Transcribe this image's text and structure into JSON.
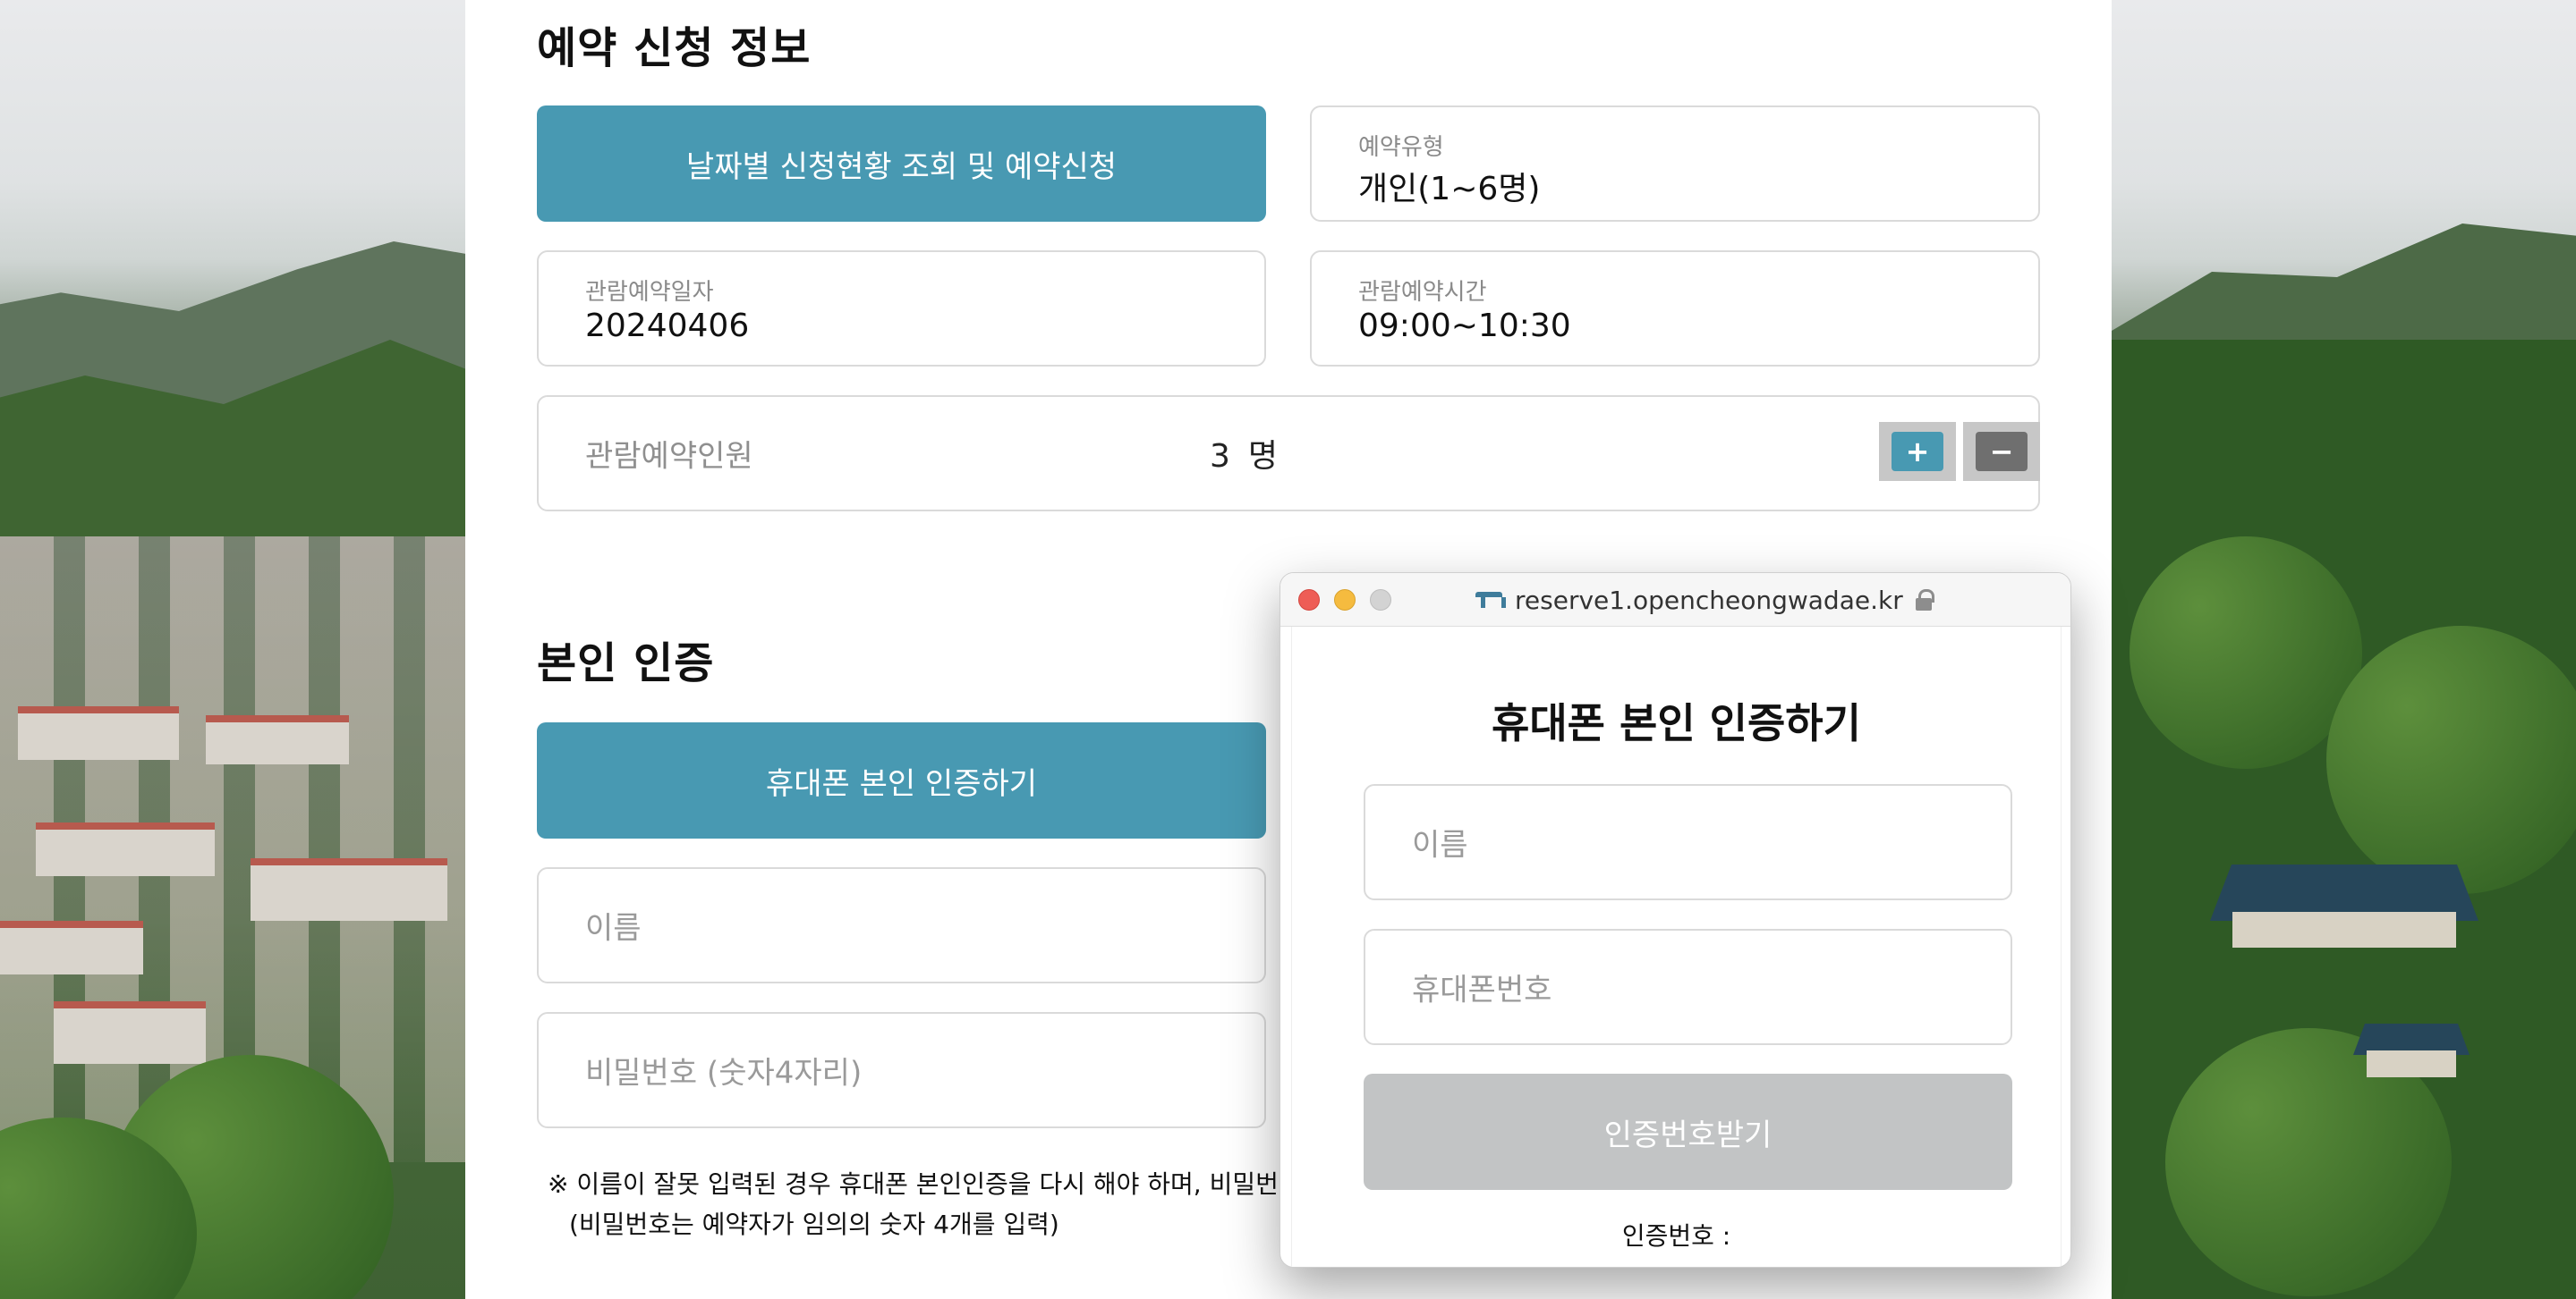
{
  "reservation": {
    "title": "예약 신청 정보",
    "date_status_button": "날짜별 신청현황 조회 및 예약신청",
    "type_label": "예약유형",
    "type_value": "개인(1~6명)",
    "date_label": "관람예약일자",
    "date_value": "20240406",
    "time_label": "관람예약시간",
    "time_value": "09:00~10:30",
    "people_label": "관람예약인원",
    "people_count": "3",
    "people_unit": "명",
    "plus": "+",
    "minus": "−"
  },
  "auth": {
    "title": "본인 인증",
    "phone_auth_button": "휴대폰 본인 인증하기",
    "name_placeholder": "이름",
    "password_placeholder": "비밀번호 (숫자4자리)",
    "note_line1": "※ 이름이 잘못 입력된 경우 휴대폰 본인인증을 다시 해야 하며, 비밀번호는",
    "note_line2": "(비밀번호는 예약자가 임의의 숫자 4개를 입력)"
  },
  "popup": {
    "url": "reserve1.opencheongwadae.kr",
    "title": "휴대폰 본인 인증하기",
    "name_placeholder": "이름",
    "phone_placeholder": "휴대폰번호",
    "request_code_button": "인증번호받기",
    "code_label": "인증번호 :"
  },
  "colors": {
    "primary": "#4899b2",
    "disabled": "#c2c4c5",
    "minus_button": "#6f6f6f"
  }
}
